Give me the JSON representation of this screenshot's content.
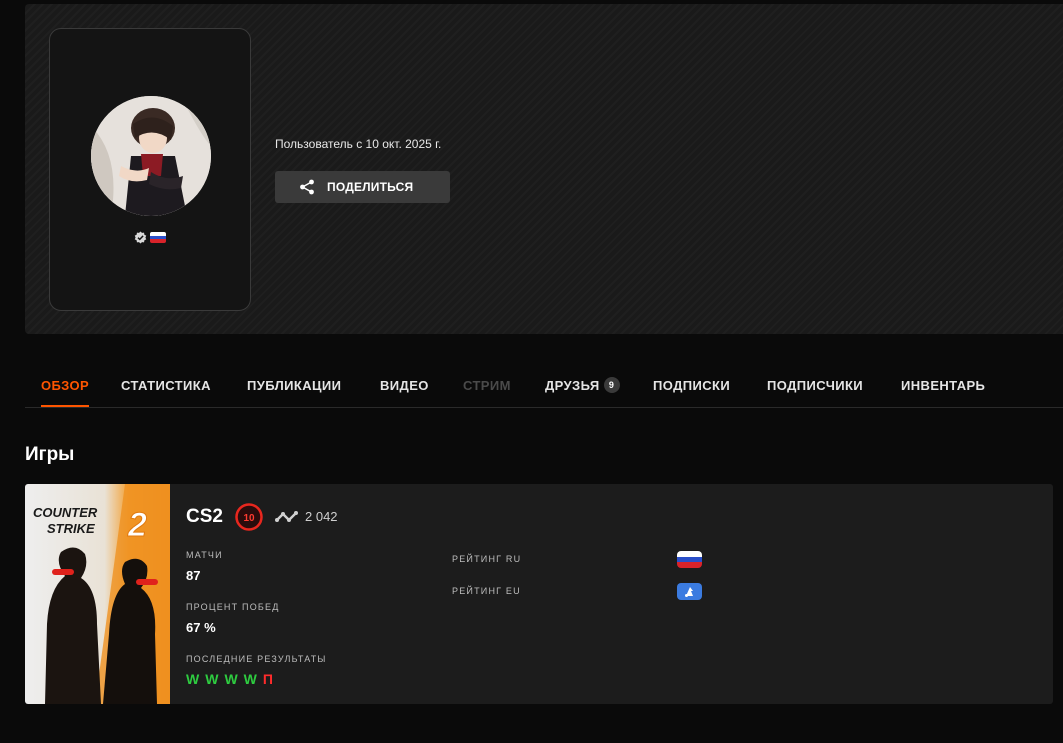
{
  "profile": {
    "member_since": "Пользователь с 10 окт. 2025 г.",
    "share_label": "ПОДЕЛИТЬСЯ"
  },
  "tabs": [
    {
      "label": "ОБЗОР",
      "active": true
    },
    {
      "label": "СТАТИСТИКА"
    },
    {
      "label": "ПУБЛИКАЦИИ"
    },
    {
      "label": "ВИДЕО"
    },
    {
      "label": "СТРИМ",
      "disabled": true
    },
    {
      "label": "ДРУЗЬЯ",
      "badge": "9"
    },
    {
      "label": "ПОДПИСКИ"
    },
    {
      "label": "ПОДПИСЧИКИ"
    },
    {
      "label": "ИНВЕНТАРЬ"
    }
  ],
  "games_section": {
    "title": "Игры"
  },
  "game": {
    "cover_title_line1": "COUNTER",
    "cover_title_line2": "STRIKE",
    "cover_number": "2",
    "name": "CS2",
    "level": "10",
    "elo": "2 042",
    "matches_label": "МАТЧИ",
    "matches_value": "87",
    "winrate_label": "ПРОЦЕНТ ПОБЕД",
    "winrate_value": "67 %",
    "recent_label": "ПОСЛЕДНИЕ РЕЗУЛЬТАТЫ",
    "recent_results": [
      "W",
      "W",
      "W",
      "W",
      "П"
    ],
    "rating_ru_label": "РЕЙТИНГ RU",
    "rating_eu_label": "РЕЙТИНГ EU"
  },
  "colors": {
    "accent": "#ff5500",
    "win": "#2ecc40",
    "loss": "#ff2b2b"
  },
  "icons": [
    "verified-icon",
    "ru-flag-icon",
    "share-icon",
    "level-icon",
    "elo-icon",
    "eu-flag-icon"
  ]
}
